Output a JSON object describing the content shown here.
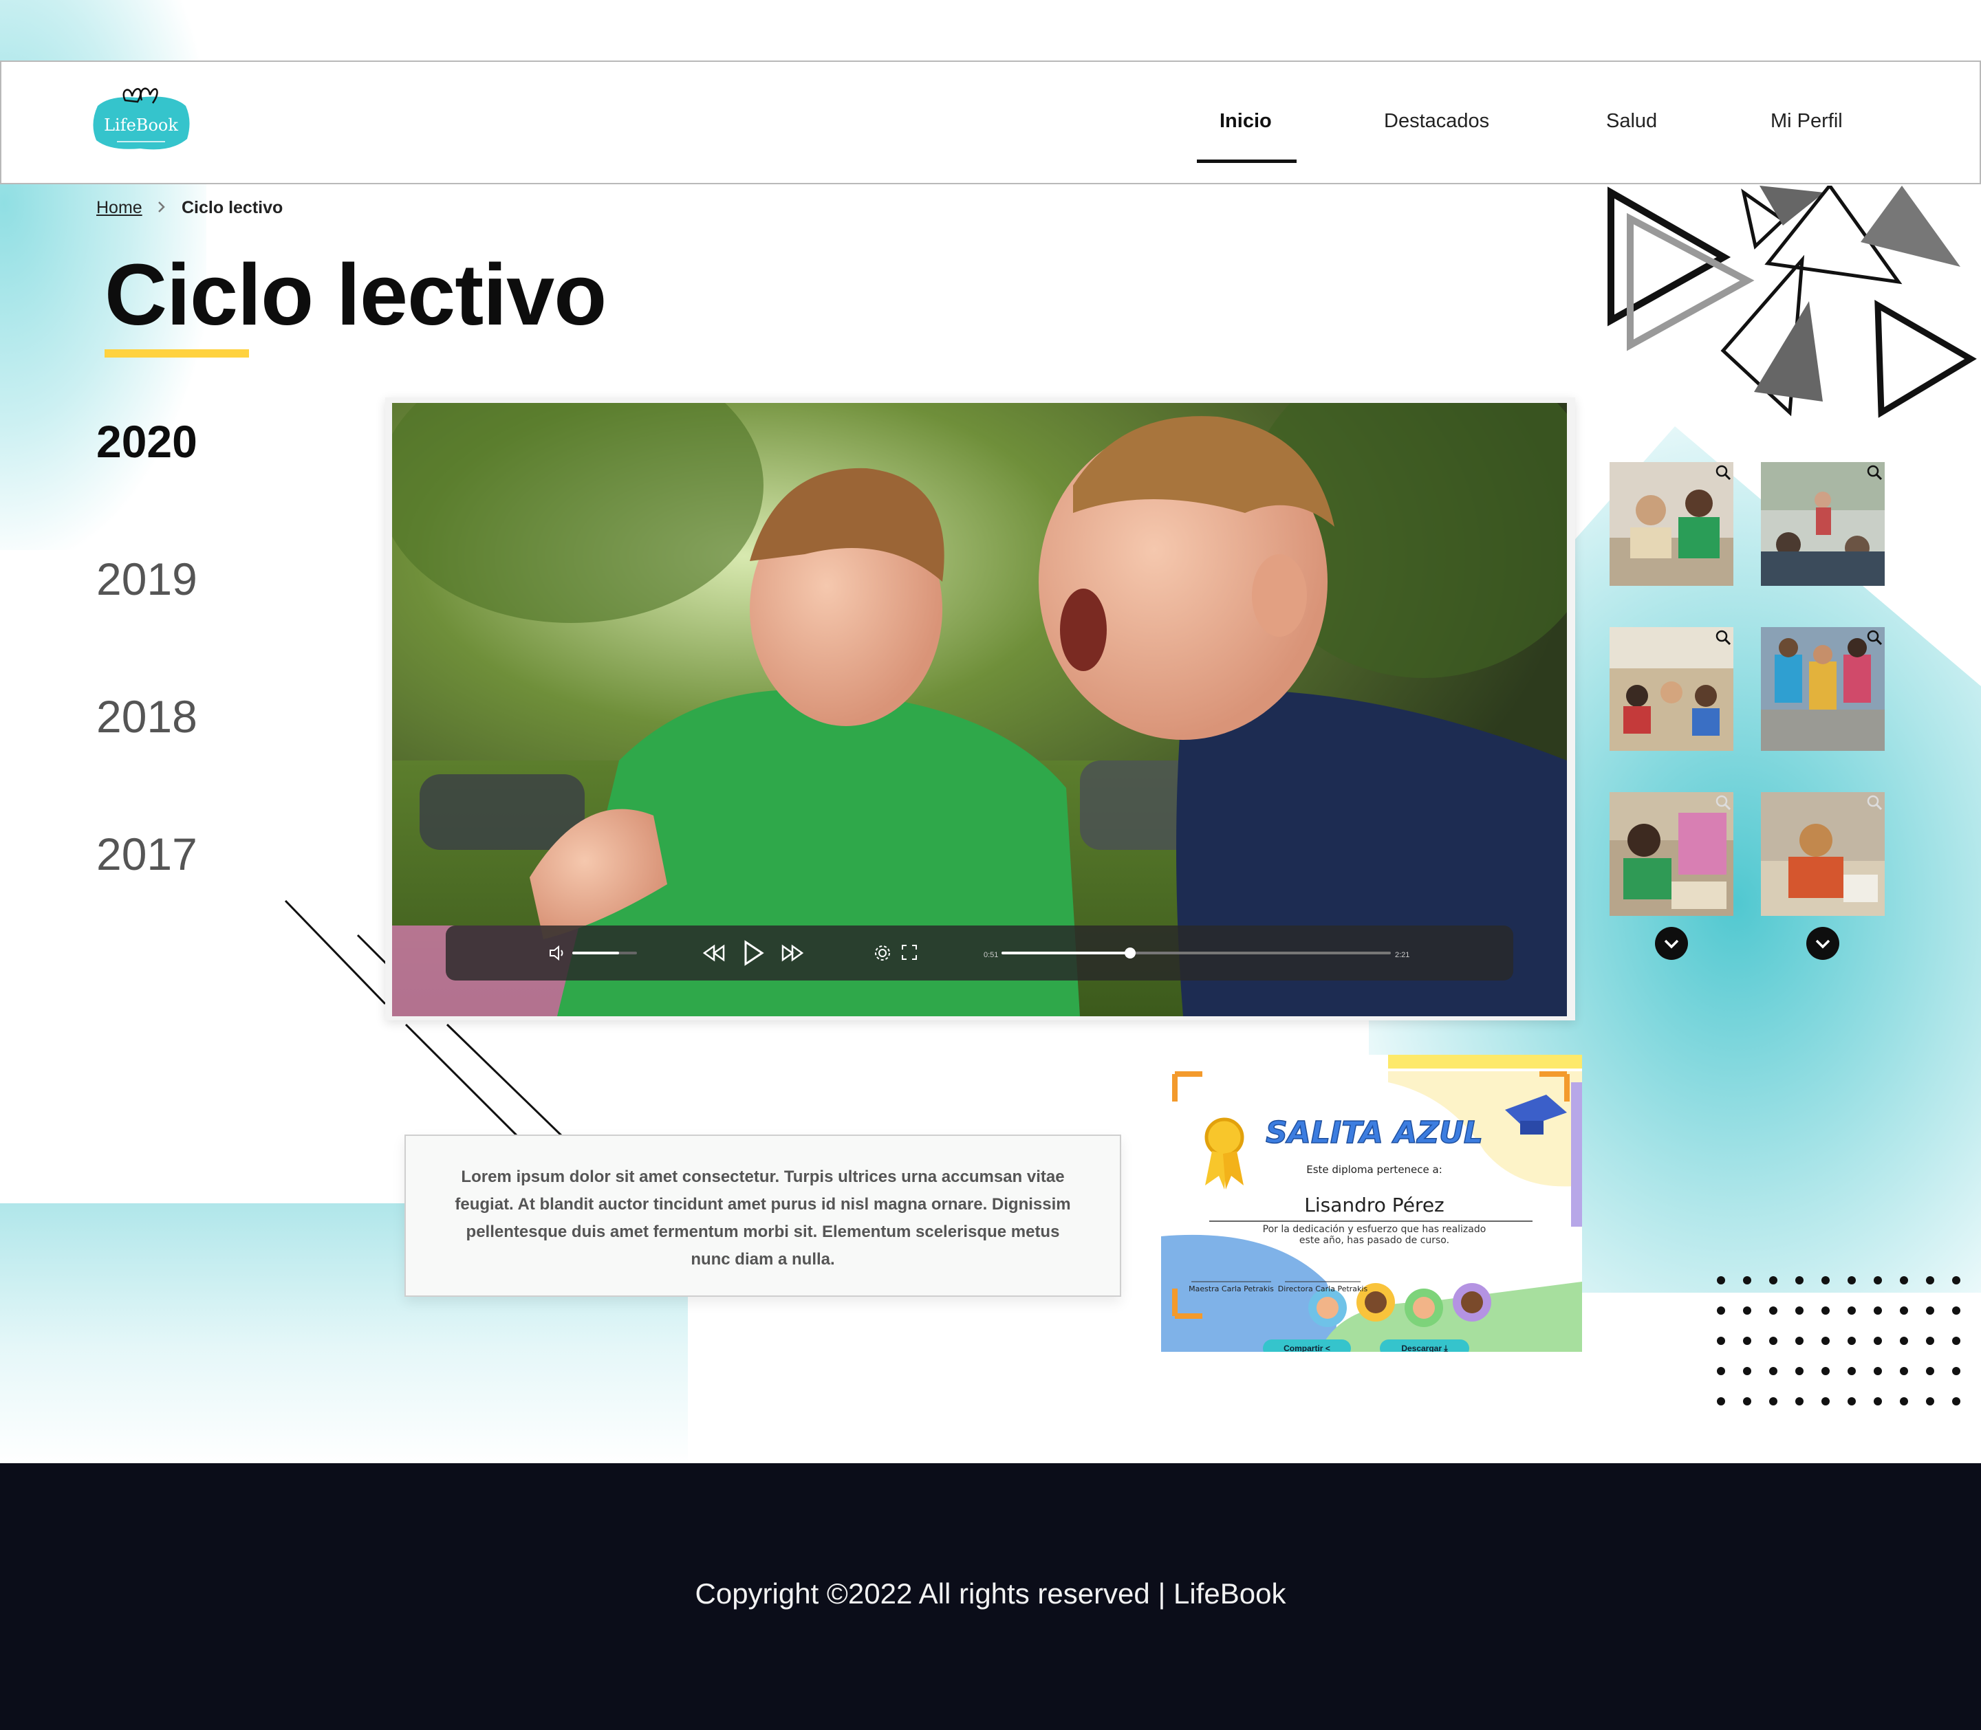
{
  "nav": {
    "brand": "LifeBook",
    "items": [
      "Inicio",
      "Destacados",
      "Salud",
      "Mi Perfil"
    ],
    "active": "Inicio"
  },
  "breadcrumb": {
    "home": "Home",
    "separator": ">",
    "current": "Ciclo lectivo"
  },
  "page_title": "Ciclo lectivo",
  "years": [
    "2020",
    "2019",
    "2018",
    "2017"
  ],
  "active_year": "2020",
  "video": {
    "time_current": "0:51",
    "time_total": "2:21",
    "progress": 0.33,
    "volume": 0.72
  },
  "description": "Lorem ipsum dolor sit amet consectetur. Turpis ultrices urna accumsan vitae feugiat. At blandit auctor tincidunt amet purus id nisl magna ornare. Dignissim pellentesque duis amet fermentum morbi sit. Elementum scelerisque metus nunc diam a nulla.",
  "diploma": {
    "title": "SALITA AZUL",
    "belongs_to": "Este diploma pertenece a:",
    "student": "Lisandro Pérez",
    "dedication_line1": "Por la dedicación y esfuerzo que has realizado",
    "dedication_line2": "este año, has pasado de curso.",
    "teacher": "Maestra Carla Petrakis",
    "director": "Directora Carla Petrakis",
    "share_label": "Compartir",
    "download_label": "Descargar"
  },
  "footer": {
    "copyright": "Copyright ©2022 All rights reserved | LifeBook"
  },
  "colors": {
    "accent_teal": "#35c4cc",
    "accent_yellow": "#ffd23f",
    "footer_bg": "#0b0d19",
    "diploma_blue": "#3c7de0"
  }
}
